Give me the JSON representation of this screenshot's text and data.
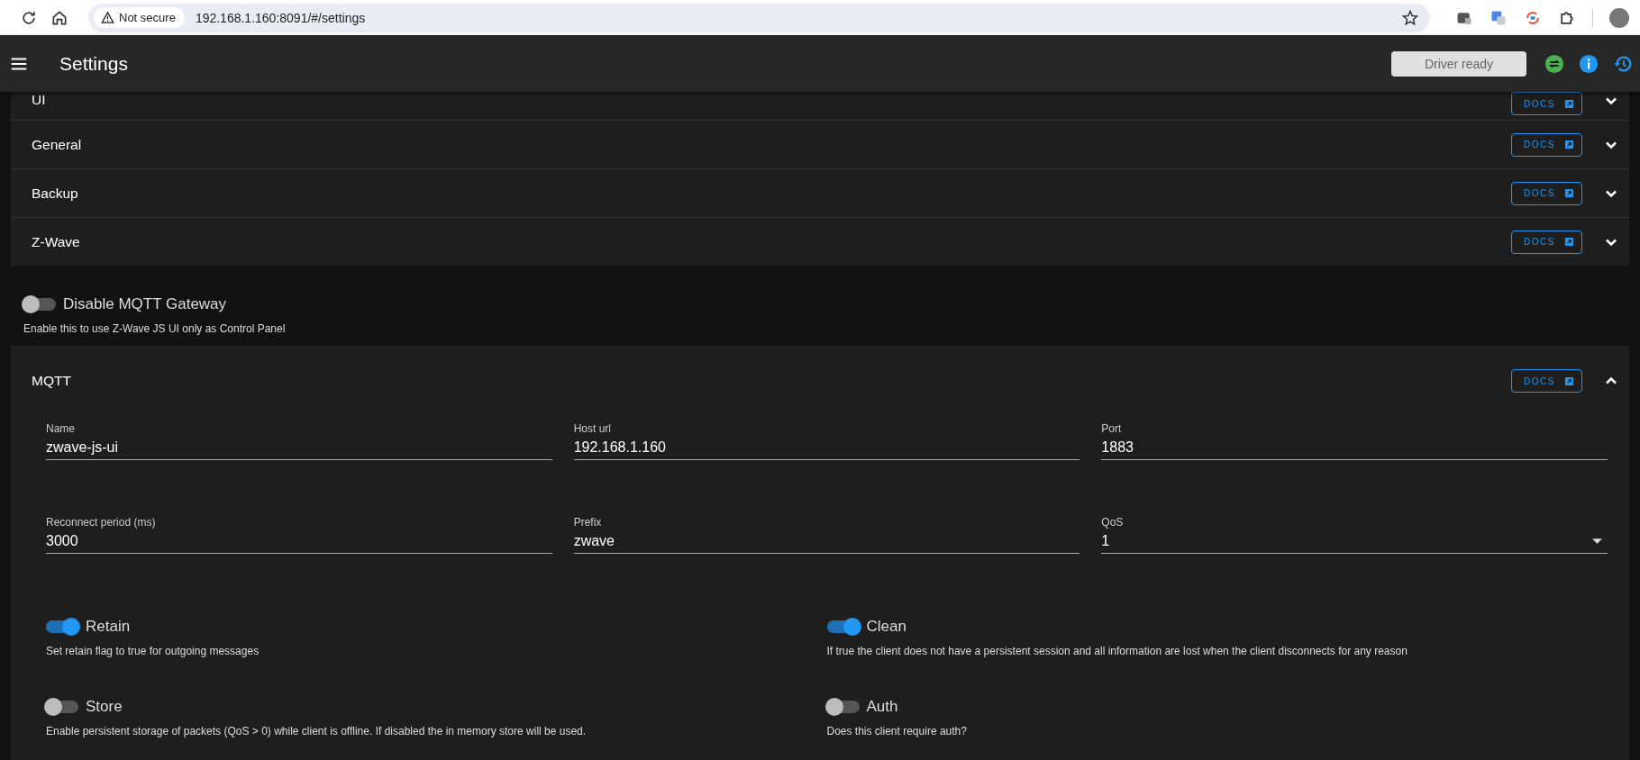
{
  "browser": {
    "security": "Not secure",
    "url": "192.168.1.160:8091/#/settings"
  },
  "app_bar": {
    "title": "Settings",
    "status": "Driver ready"
  },
  "sections": [
    {
      "title": "UI",
      "docs": "DOCS",
      "expanded": false
    },
    {
      "title": "General",
      "docs": "DOCS",
      "expanded": false
    },
    {
      "title": "Backup",
      "docs": "DOCS",
      "expanded": false
    },
    {
      "title": "Z-Wave",
      "docs": "DOCS",
      "expanded": false
    }
  ],
  "gateway_toggle": {
    "label": "Disable MQTT Gateway",
    "hint": "Enable this to use Z-Wave JS UI only as Control Panel",
    "on": false
  },
  "mqtt": {
    "title": "MQTT",
    "docs": "DOCS",
    "expanded": true,
    "fields": [
      {
        "label": "Name",
        "value": "zwave-js-ui",
        "kind": "text"
      },
      {
        "label": "Host url",
        "value": "192.168.1.160",
        "kind": "text"
      },
      {
        "label": "Port",
        "value": "1883",
        "kind": "text"
      },
      {
        "label": "Reconnect period (ms)",
        "value": "3000",
        "kind": "text"
      },
      {
        "label": "Prefix",
        "value": "zwave",
        "kind": "text"
      },
      {
        "label": "QoS",
        "value": "1",
        "kind": "select"
      }
    ],
    "switches": [
      {
        "label": "Retain",
        "hint": "Set retain flag to true for outgoing messages",
        "on": true
      },
      {
        "label": "Clean",
        "hint": "If true the client does not have a persistent session and all information are lost when the client disconnects for any reason",
        "on": true
      },
      {
        "label": "Store",
        "hint": "Enable persistent storage of packets (QoS > 0) while client is offline. If disabled the in memory store will be used.",
        "on": false
      },
      {
        "label": "Auth",
        "hint": "Does this client require auth?",
        "on": false
      }
    ]
  }
}
